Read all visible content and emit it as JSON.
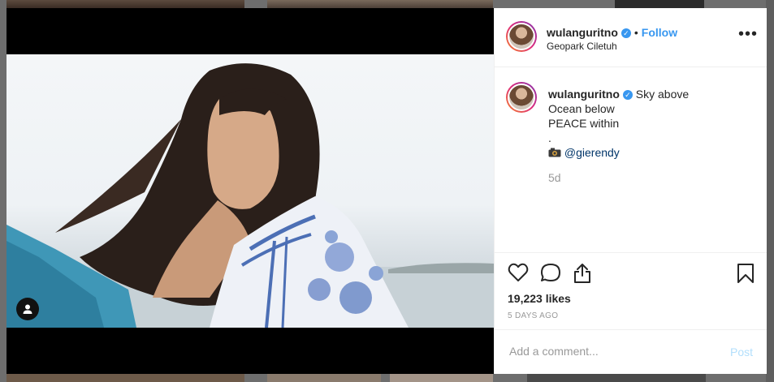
{
  "post": {
    "username": "wulanguritno",
    "follow_label": "Follow",
    "location": "Geopark Ciletuh",
    "more_label": "•••",
    "caption_lines": [
      "Sky above",
      "Ocean below",
      "PEACE within",
      "."
    ],
    "credit_handle": "@gierendy",
    "time_ago": "5d",
    "likes": "19,223 likes",
    "date": "5 DAYS AGO",
    "comment_placeholder": "Add a comment...",
    "post_label": "Post"
  },
  "icons": {
    "verified": "verified-badge-icon",
    "camera": "camera-emoji-icon",
    "like": "heart-icon",
    "comment": "comment-bubble-icon",
    "share": "share-icon",
    "save": "bookmark-icon",
    "tag": "user-tag-icon"
  },
  "colors": {
    "accent": "#3897f0",
    "text": "#262626",
    "muted": "#999999",
    "post_disabled": "#b2dffc"
  }
}
